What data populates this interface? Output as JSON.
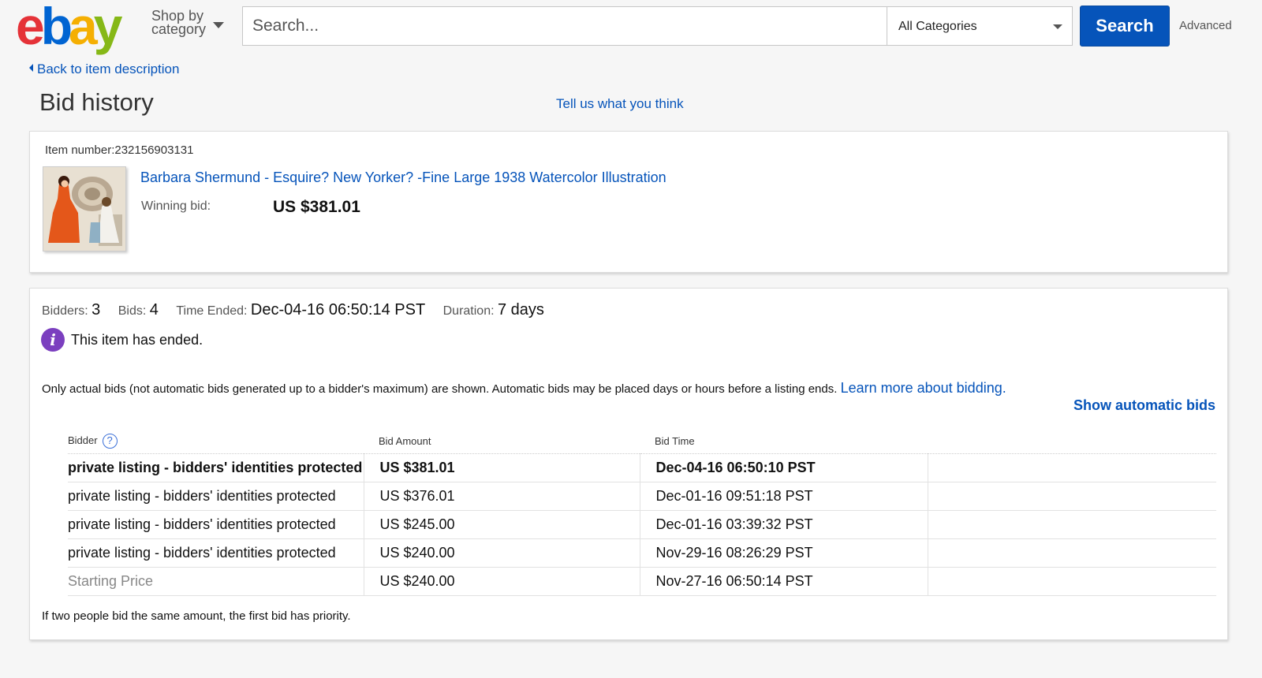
{
  "header": {
    "logo_letters": [
      "e",
      "b",
      "a",
      "y"
    ],
    "shop_by_label": "Shop by category",
    "search_placeholder": "Search...",
    "category_selected": "All Categories",
    "search_button": "Search",
    "advanced_link": "Advanced"
  },
  "nav": {
    "back_link": "Back to item description",
    "page_title": "Bid history",
    "feedback_link": "Tell us what you think"
  },
  "item": {
    "number_label": "Item number:",
    "number_value": "232156903131",
    "title": "Barbara Shermund - Esquire? New Yorker? -Fine Large 1938 Watercolor Illustration",
    "winning_label": "Winning bid:",
    "winning_value": "US $381.01"
  },
  "summary": {
    "bidders_label": "Bidders:",
    "bidders_value": "3",
    "bids_label": "Bids:",
    "bids_value": "4",
    "time_ended_label": "Time Ended:",
    "time_ended_value": "Dec-04-16 06:50:14 PST",
    "duration_label": "Duration:",
    "duration_value": "7 days",
    "ended_message": "This item has ended.",
    "info_icon_glyph": "i"
  },
  "notice": {
    "text": "Only actual bids (not automatic bids generated up to a bidder's maximum) are shown. Automatic bids may be placed days or hours before a listing ends. ",
    "learn_more": "Learn more about bidding.",
    "show_automatic": "Show automatic bids"
  },
  "table": {
    "headers": {
      "bidder": "Bidder",
      "help_glyph": "?",
      "amount": "Bid Amount",
      "time": "Bid Time"
    },
    "rows": [
      {
        "bidder": "private listing - bidders' identities protected",
        "amount": "US $381.01",
        "time": "Dec-04-16 06:50:10 PST"
      },
      {
        "bidder": "private listing - bidders' identities protected",
        "amount": "US $376.01",
        "time": "Dec-01-16 09:51:18 PST"
      },
      {
        "bidder": "private listing - bidders' identities protected",
        "amount": "US $245.00",
        "time": "Dec-01-16 03:39:32 PST"
      },
      {
        "bidder": "private listing - bidders' identities protected",
        "amount": "US $240.00",
        "time": "Nov-29-16 08:26:29 PST"
      },
      {
        "bidder": "Starting Price",
        "amount": "US $240.00",
        "time": "Nov-27-16 06:50:14 PST"
      }
    ]
  },
  "footnote": "If two people bid the same amount, the first bid has priority.",
  "colors": {
    "link": "#0654ba",
    "search_button": "#0654ba",
    "info_icon": "#7b3fbf"
  }
}
